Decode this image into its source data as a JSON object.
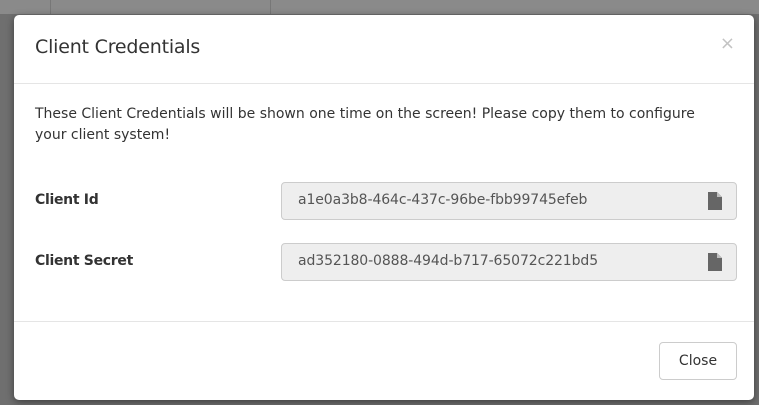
{
  "modal": {
    "title": "Client Credentials",
    "close_glyph": "×",
    "intro": "These Client Credentials will be shown one time on the screen! Please copy them to configure your client system!",
    "fields": [
      {
        "label": "Client Id",
        "value": "a1e0a3b8-464c-437c-96be-fbb99745efeb",
        "icon": "copy-file-icon"
      },
      {
        "label": "Client Secret",
        "value": "ad352180-0888-494d-b717-65072c221bd5",
        "icon": "copy-file-icon"
      }
    ],
    "close_button_label": "Close"
  },
  "colors": {
    "backdrop": "#6f6f6f",
    "text": "#333333",
    "field_bg": "#eeeeee",
    "field_border": "#cccccc",
    "icon": "#666666"
  }
}
